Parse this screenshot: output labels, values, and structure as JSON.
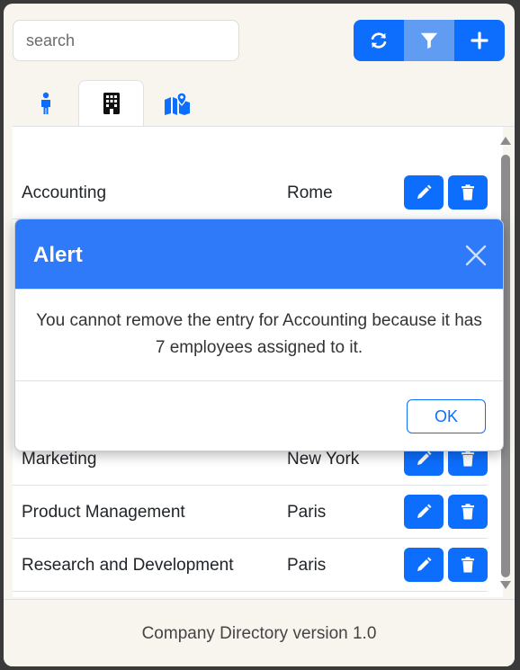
{
  "search": {
    "placeholder": "search"
  },
  "toolbar": {
    "buttons": [
      {
        "icon": "refresh-icon"
      },
      {
        "icon": "filter-icon",
        "active": true
      },
      {
        "icon": "plus-icon"
      }
    ]
  },
  "tabs": [
    {
      "icon": "person-icon"
    },
    {
      "icon": "building-icon",
      "active": true
    },
    {
      "icon": "map-location-icon"
    }
  ],
  "rows": [
    {
      "name": "Accounting",
      "location": "Rome"
    },
    {
      "name": "Marketing",
      "location": "New York"
    },
    {
      "name": "Product Management",
      "location": "Paris"
    },
    {
      "name": "Research and Development",
      "location": "Paris"
    }
  ],
  "footer": {
    "text": "Company Directory version 1.0"
  },
  "modal": {
    "title": "Alert",
    "message": "You cannot remove the entry for Accounting because it has 7 employees assigned to it.",
    "ok_label": "OK"
  },
  "colors": {
    "primary": "#0d6efd",
    "modal_header": "#2f7af8",
    "background": "#f7f5ee"
  }
}
